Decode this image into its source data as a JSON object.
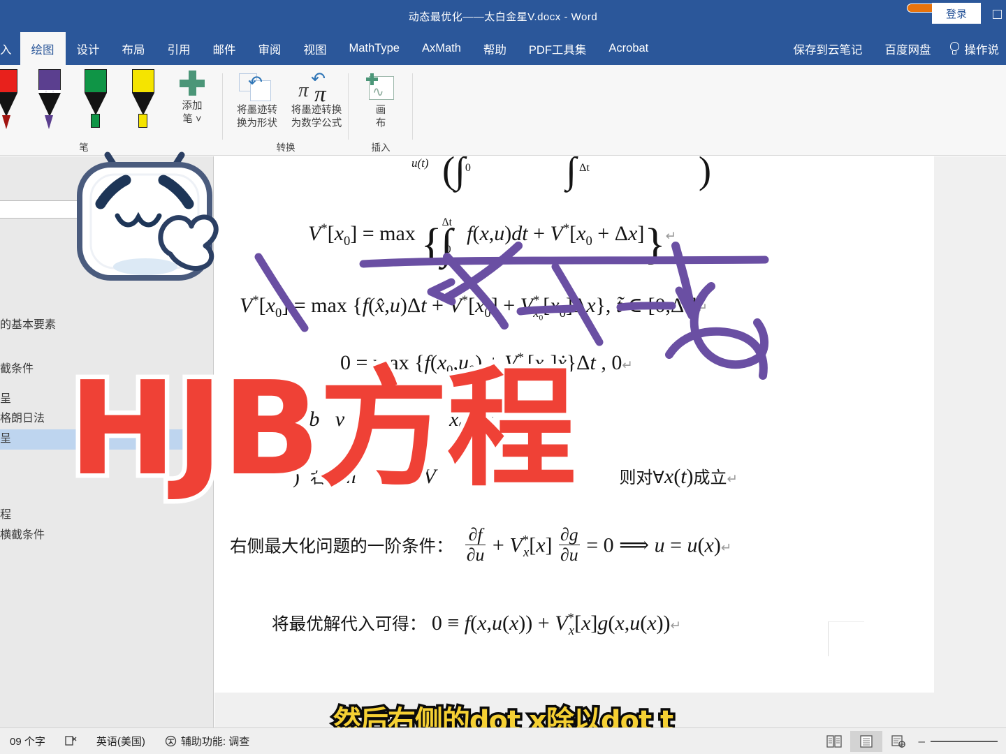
{
  "titlebar": {
    "document_title": "动态最优化——太白金星V.docx  -  Word",
    "login_label": "登录",
    "restore_icon": "restore-window-icon"
  },
  "tabs": [
    {
      "label": "入",
      "active": false
    },
    {
      "label": "绘图",
      "active": true
    },
    {
      "label": "设计",
      "active": false
    },
    {
      "label": "布局",
      "active": false
    },
    {
      "label": "引用",
      "active": false
    },
    {
      "label": "邮件",
      "active": false
    },
    {
      "label": "审阅",
      "active": false
    },
    {
      "label": "视图",
      "active": false
    },
    {
      "label": "MathType",
      "active": false
    },
    {
      "label": "AxMath",
      "active": false
    },
    {
      "label": "帮助",
      "active": false
    },
    {
      "label": "PDF工具集",
      "active": false
    },
    {
      "label": "Acrobat",
      "active": false
    },
    {
      "label": "保存到云笔记",
      "active": false
    },
    {
      "label": "百度网盘",
      "active": false
    }
  ],
  "tell_me": {
    "label": "操作说",
    "icon": "lightbulb-icon"
  },
  "ribbon": {
    "groups": [
      {
        "name": "pens",
        "label": "笔"
      },
      {
        "name": "convert",
        "label": "转换"
      },
      {
        "name": "insert",
        "label": "插入"
      }
    ],
    "pens": [
      {
        "name": "red-pen",
        "color": "#e8211c",
        "type": "pen"
      },
      {
        "name": "purple-pencil",
        "color": "#5b3f8f",
        "type": "pencil"
      },
      {
        "name": "green-highlighter",
        "color": "#0f9546",
        "type": "highlighter"
      },
      {
        "name": "yellow-highlighter",
        "color": "#f5e400",
        "type": "highlighter"
      }
    ],
    "add_pen": {
      "label_line1": "添加",
      "label_line2": "笔",
      "chevron": "chevron-down-icon"
    },
    "convert_buttons": [
      {
        "name": "ink-to-shape",
        "line1": "将墨迹转",
        "line2": "换为形状"
      },
      {
        "name": "ink-to-math",
        "line1": "将墨迹转换",
        "line2": "为数学公式"
      }
    ],
    "insert_buttons": [
      {
        "name": "drawing-canvas",
        "line1": "画",
        "line2": "布"
      }
    ]
  },
  "navigation": {
    "search_placeholder": "",
    "items": [
      {
        "label": "的基本要素",
        "selected": false
      },
      {
        "label": "截条件",
        "selected": false
      },
      {
        "label": "呈",
        "selected": false
      },
      {
        "label": "格朗日法",
        "selected": false
      },
      {
        "label": "呈",
        "selected": true
      },
      {
        "label": "程",
        "selected": false
      },
      {
        "label": "横截条件",
        "selected": false
      }
    ]
  },
  "document": {
    "lines": [
      {
        "id": "l0_partial",
        "text": "u(t)   ( ∫₀          ∫_Δt          )"
      },
      {
        "id": "l1",
        "text": "V*[x₀] = max { ∫₀^Δt f(x,u)dt + V*[x₀ + Δx] }"
      },
      {
        "id": "l2",
        "text": "V*[x₀] = max {f(x̃,u)Δt + V*[x₀] + V*_{x₀}[x₀]Δx}, t̃ ∈ [0,Δt]"
      },
      {
        "id": "l3",
        "text": "0 = max {f(x₀,u₀) + V*_{x₀}[x₀]ẋ}Δt , 0"
      },
      {
        "id": "l4",
        "text": "… (x₀,u₀)}"
      },
      {
        "id": "l5",
        "text": "… 则对∀x(t)成立"
      },
      {
        "id": "l6_label",
        "text": "右侧最大化问题的一阶条件："
      },
      {
        "id": "l6_math",
        "text": "∂f/∂u + V*_x[x] ∂g/∂u = 0 ⟹ u = u(x)"
      },
      {
        "id": "l7_label",
        "text": "将最优解代入可得："
      },
      {
        "id": "l7_math",
        "text": "0 ≡ f(x,u(x)) + V*_x[x] g(x,u(x))"
      }
    ]
  },
  "overlay": {
    "big_title": "HJB方程",
    "big_title_color": "#ef4136",
    "big_title_stroke": "#ffffff",
    "subtitle": "然后右侧的dot x除以dot t",
    "subtitle_color": "#f5d033",
    "subtitle_stroke": "#0b0b0b",
    "ink_color": "#6a4fa3",
    "mascot": "bilibili-mascot-icon"
  },
  "statusbar": {
    "word_count": "09 个字",
    "proofing_icon": "proofing-errors-icon",
    "language": "英语(美国)",
    "accessibility": "辅助功能: 调查",
    "views": [
      {
        "name": "read-mode-view",
        "icon": "book-icon",
        "active": false
      },
      {
        "name": "print-layout-view",
        "icon": "page-icon",
        "active": true
      },
      {
        "name": "web-layout-view",
        "icon": "web-icon",
        "active": false
      }
    ],
    "zoom_minus": "–"
  }
}
